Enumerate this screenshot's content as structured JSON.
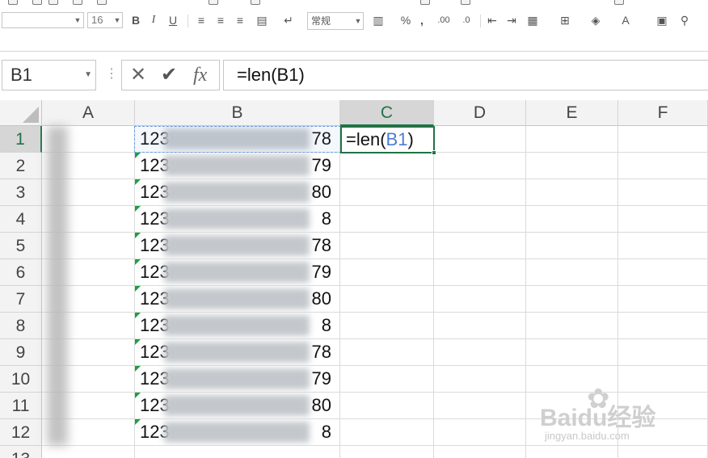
{
  "ribbon": {
    "font_size": "16",
    "bold_label": "B",
    "italic_label": "I",
    "underline_label": "U",
    "number_format": "常规",
    "percent_label": "%",
    "comma_label": ",",
    "font_color_label": "A"
  },
  "formula_bar": {
    "name_box": "B1",
    "cancel_symbol": "✕",
    "enter_symbol": "✔",
    "fx_label": "fx",
    "formula": "=len(B1)"
  },
  "columns": [
    "A",
    "B",
    "C",
    "D",
    "E",
    "F"
  ],
  "rows": [
    "1",
    "2",
    "3",
    "4",
    "5",
    "6",
    "7",
    "8",
    "9",
    "10",
    "11",
    "12",
    "13"
  ],
  "cells_b": [
    {
      "prefix": "123",
      "suffix": "78"
    },
    {
      "prefix": "123",
      "suffix": "79"
    },
    {
      "prefix": "123",
      "suffix": "80"
    },
    {
      "prefix": "123",
      "suffix": "8"
    },
    {
      "prefix": "123",
      "suffix": "78"
    },
    {
      "prefix": "123",
      "suffix": "79"
    },
    {
      "prefix": "123",
      "suffix": "80"
    },
    {
      "prefix": "123",
      "suffix": "8"
    },
    {
      "prefix": "123",
      "suffix": "78"
    },
    {
      "prefix": "123",
      "suffix": "79"
    },
    {
      "prefix": "123",
      "suffix": "80"
    },
    {
      "prefix": "123",
      "suffix": "8"
    }
  ],
  "c1": {
    "prefix": "=len(",
    "ref": "B1",
    "suffix": ")"
  },
  "watermark": {
    "brand": "Baidu经验",
    "url": "jingyan.baidu.com"
  },
  "colors": {
    "accent": "#217346",
    "ref_blue": "#4a7ed4",
    "error_triangle": "#1e9e3e"
  }
}
